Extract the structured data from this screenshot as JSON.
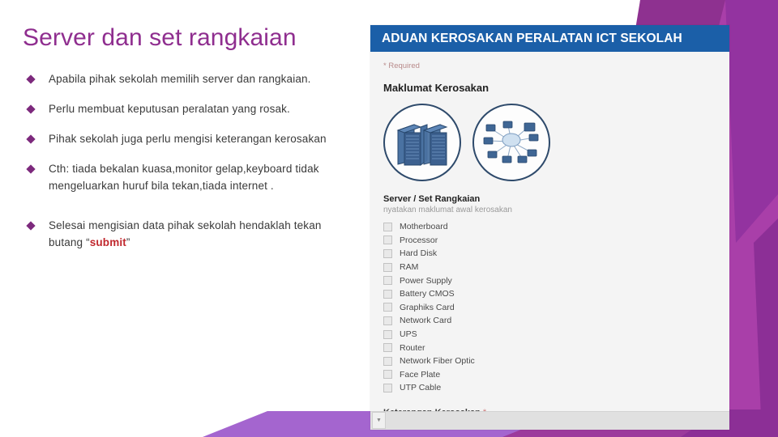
{
  "slide": {
    "title": "Server dan set rangkaian",
    "title_color": "#8f2e8f",
    "bullet_color": "#7d2a7d",
    "bullets": [
      {
        "text": "Apabila pihak sekolah memilih server dan rangkaian."
      },
      {
        "text": "Perlu membuat keputusan peralatan yang rosak."
      },
      {
        "text": "Pihak sekolah juga perlu mengisi keterangan kerosakan"
      },
      {
        "text": "Cth: tiada bekalan kuasa,monitor gelap,keyboard tidak mengeluarkan huruf bila tekan,tiada  internet ."
      }
    ],
    "final_bullet": {
      "prefix": "Selesai mengisian data pihak sekolah hendaklah tekan butang “",
      "highlight": "submit",
      "highlight_color": "#c0272d",
      "suffix": "”"
    }
  },
  "form": {
    "header_title": "ADUAN KEROSAKAN PERALATAN ICT SEKOLAH",
    "header_color": "#1b5fa8",
    "required_note": "* Required",
    "section_heading": "Maklumat Kerosakan",
    "illustrations": [
      {
        "name": "server-rack-illustration"
      },
      {
        "name": "network-diagram-illustration"
      }
    ],
    "field": {
      "label": "Server / Set Rangkaian",
      "sublabel": "nyatakan maklumat awal kerosakan",
      "options": [
        "Motherboard",
        "Processor",
        "Hard Disk",
        "RAM",
        "Power Supply",
        "Battery CMOS",
        "Graphiks Card",
        "Network Card",
        "UPS",
        "Router",
        "Network Fiber Optic",
        "Face Plate",
        "UTP Cable"
      ]
    },
    "next_field_label": "Keterangan Kerosakan",
    "next_field_star": "*",
    "scroll_down_glyph": "▼"
  }
}
